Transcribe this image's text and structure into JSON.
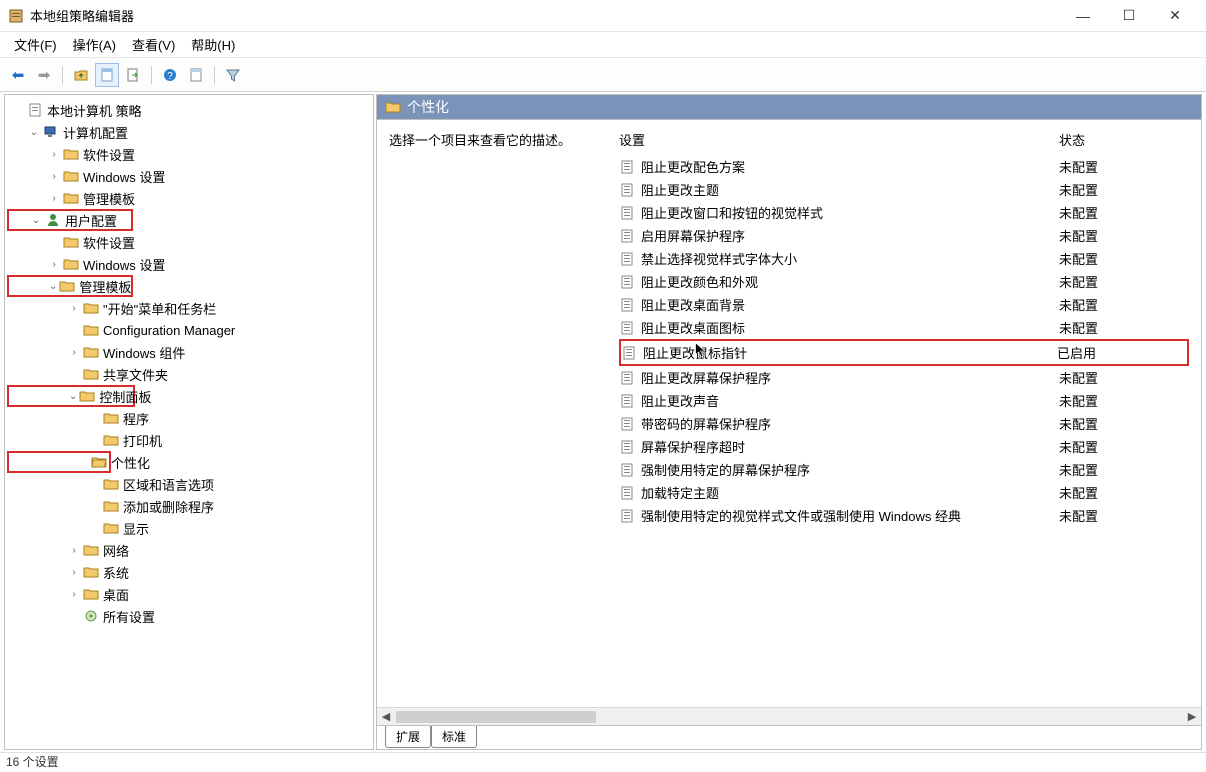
{
  "window": {
    "title": "本地组策略编辑器"
  },
  "menubar": {
    "file": "文件(F)",
    "action": "操作(A)",
    "view": "查看(V)",
    "help": "帮助(H)"
  },
  "tree": {
    "root": "本地计算机 策略",
    "computer_config": "计算机配置",
    "cc_software": "软件设置",
    "cc_windows": "Windows 设置",
    "cc_admin": "管理模板",
    "user_config": "用户配置",
    "uc_software": "软件设置",
    "uc_windows": "Windows 设置",
    "uc_admin": "管理模板",
    "start_menu": "\"开始\"菜单和任务栏",
    "config_manager": "Configuration Manager",
    "windows_components": "Windows 组件",
    "shared_folders": "共享文件夹",
    "control_panel": "控制面板",
    "cp_programs": "程序",
    "cp_printers": "打印机",
    "cp_personalization": "个性化",
    "cp_region": "区域和语言选项",
    "cp_addremove": "添加或删除程序",
    "cp_display": "显示",
    "network": "网络",
    "system": "系统",
    "desktop": "桌面",
    "all_settings": "所有设置"
  },
  "right": {
    "header": "个性化",
    "desc_prompt": "选择一个项目来查看它的描述。",
    "col_setting": "设置",
    "col_status": "状态",
    "status_unconfigured": "未配置",
    "status_enabled": "已启用",
    "settings": [
      {
        "label": "阻止更改配色方案",
        "status": "未配置"
      },
      {
        "label": "阻止更改主题",
        "status": "未配置"
      },
      {
        "label": "阻止更改窗口和按钮的视觉样式",
        "status": "未配置"
      },
      {
        "label": "启用屏幕保护程序",
        "status": "未配置"
      },
      {
        "label": "禁止选择视觉样式字体大小",
        "status": "未配置"
      },
      {
        "label": "阻止更改颜色和外观",
        "status": "未配置"
      },
      {
        "label": "阻止更改桌面背景",
        "status": "未配置"
      },
      {
        "label": "阻止更改桌面图标",
        "status": "未配置"
      },
      {
        "label": "阻止更改鼠标指针",
        "status": "已启用"
      },
      {
        "label": "阻止更改屏幕保护程序",
        "status": "未配置"
      },
      {
        "label": "阻止更改声音",
        "status": "未配置"
      },
      {
        "label": "带密码的屏幕保护程序",
        "status": "未配置"
      },
      {
        "label": "屏幕保护程序超时",
        "status": "未配置"
      },
      {
        "label": "强制使用特定的屏幕保护程序",
        "status": "未配置"
      },
      {
        "label": "加载特定主题",
        "status": "未配置"
      },
      {
        "label": "强制使用特定的视觉样式文件或强制使用 Windows 经典",
        "status": "未配置"
      }
    ],
    "tab_extended": "扩展",
    "tab_standard": "标准"
  },
  "statusbar": {
    "text": "16 个设置"
  }
}
